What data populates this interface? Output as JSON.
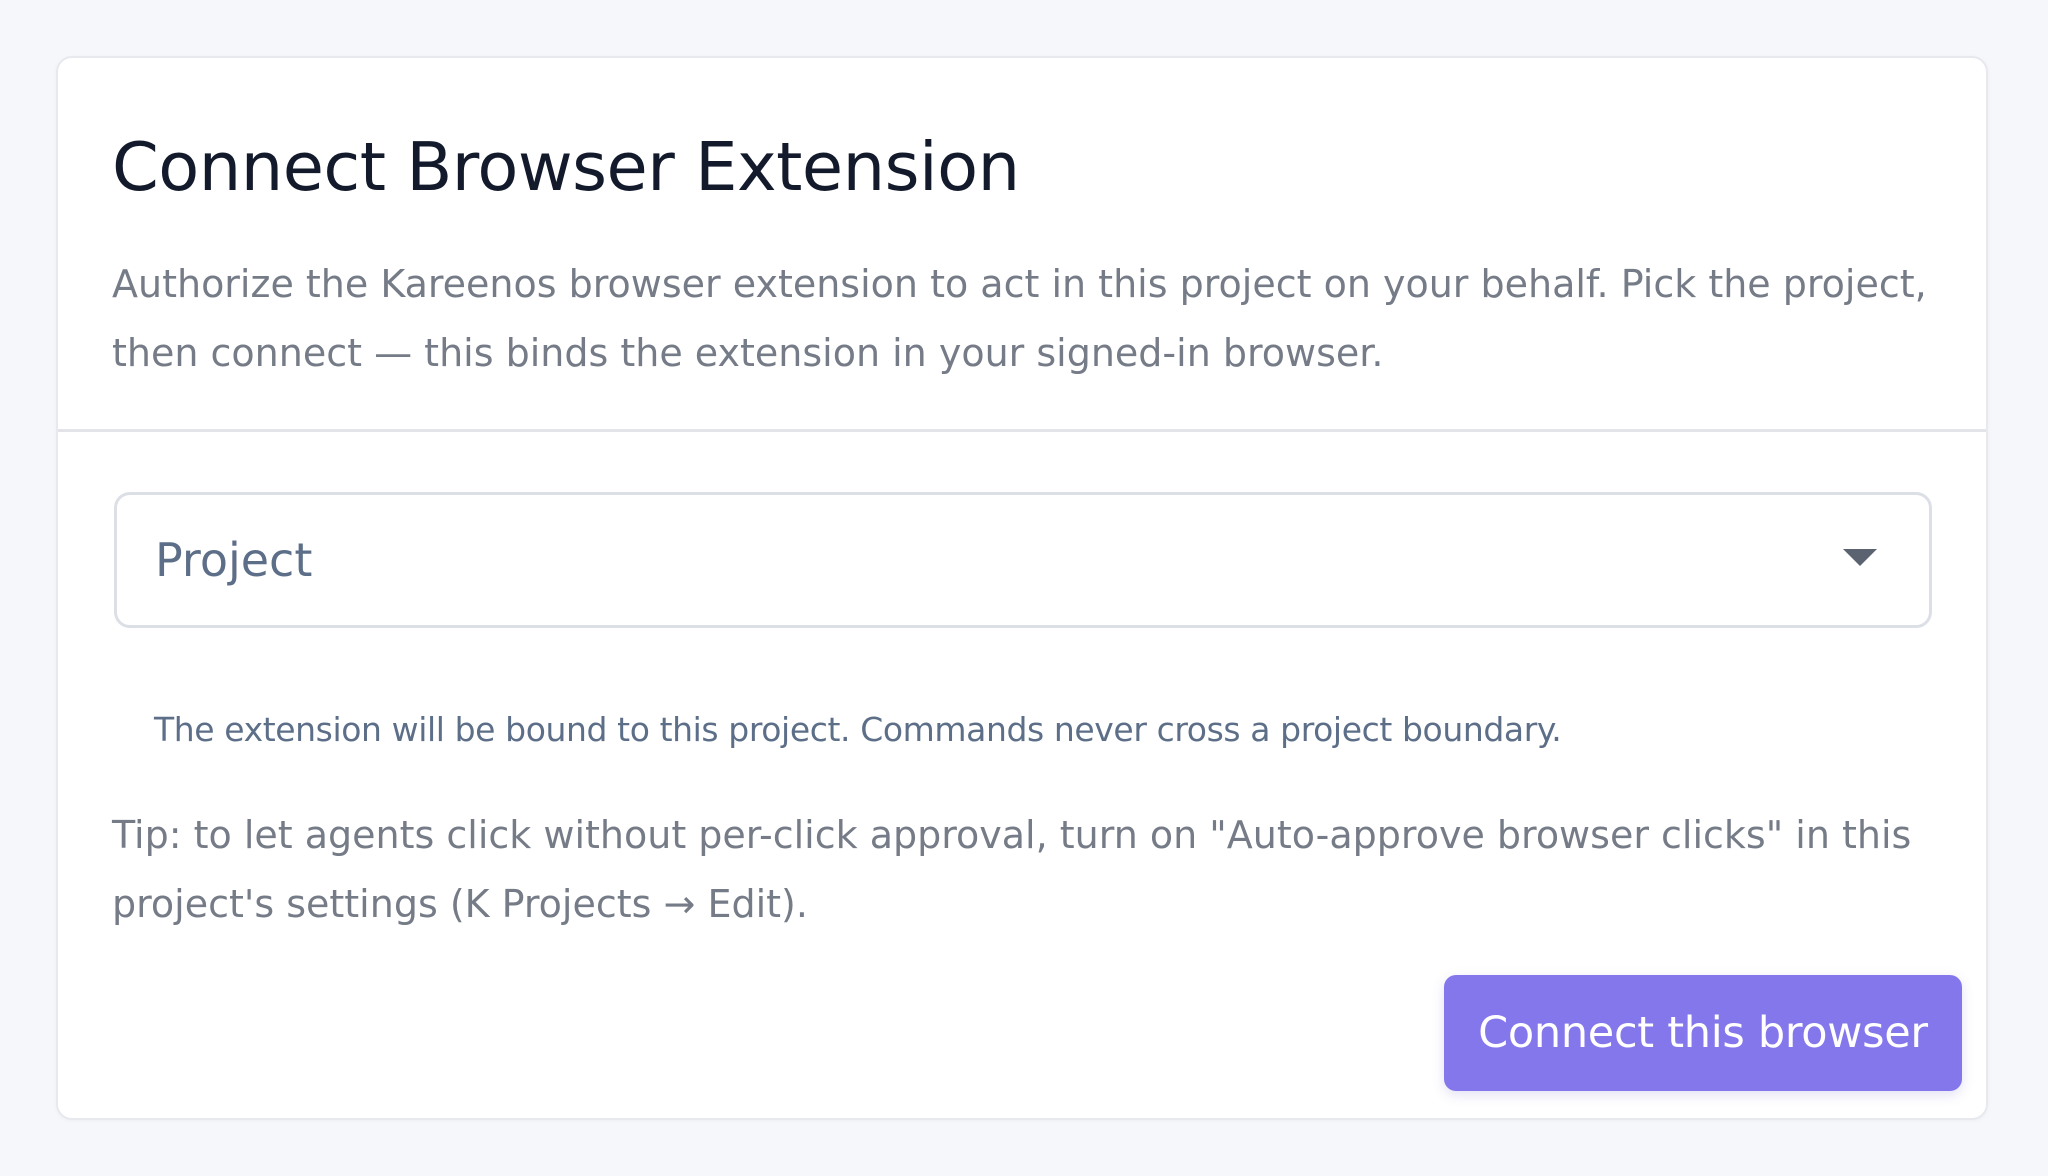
{
  "dialog": {
    "title": "Connect Browser Extension",
    "description": "Authorize the Kareenos browser extension to act in this project on your behalf. Pick the project, then connect — this binds the extension in your signed-in browser."
  },
  "project_select": {
    "label": "Project",
    "icon": "caret-down-icon",
    "helper_text": "The extension will be bound to this project. Commands never cross a project boundary."
  },
  "tip": "Tip: to let agents click without per-click approval, turn on \"Auto-approve browser clicks\" in this project's settings (K Projects → Edit).",
  "actions": {
    "connect_label": "Connect this browser"
  },
  "colors": {
    "accent": "#8477ec",
    "background": "#f6f7fb",
    "title": "#131a2b",
    "muted_text": "#767c87",
    "field_text": "#5d6f88"
  }
}
